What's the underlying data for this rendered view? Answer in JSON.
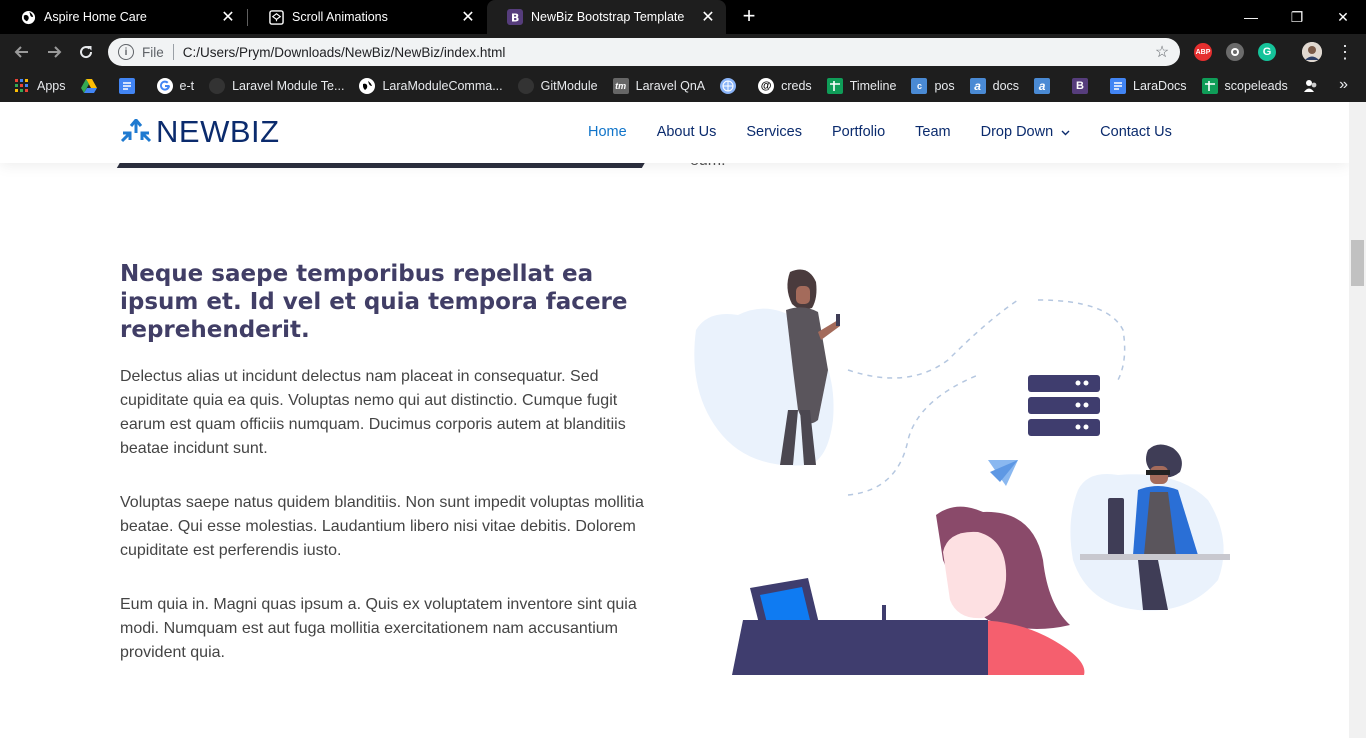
{
  "browser": {
    "tabs": [
      {
        "title": "Aspire Home Care",
        "icon": "globe-icon",
        "active": false
      },
      {
        "title": "Scroll Animations",
        "icon": "codepen-icon",
        "active": false
      },
      {
        "title": "NewBiz Bootstrap Template",
        "icon": "bootstrap-icon",
        "active": true
      }
    ],
    "new_tab": "+",
    "window_controls": {
      "minimize": "—",
      "restore": "❐",
      "close": "✕"
    },
    "omnibox": {
      "scheme": "File",
      "url": "C:/Users/Prym/Downloads/NewBiz/NewBiz/index.html"
    },
    "extensions": [
      {
        "name": "adblock-plus-icon",
        "label": "ABP",
        "color": "#e52f2f"
      },
      {
        "name": "extension-circle-icon",
        "label": "",
        "color": "#6b6b6b"
      },
      {
        "name": "grammarly-icon",
        "label": "G",
        "color": "#15c39a"
      }
    ]
  },
  "bookmarks": [
    {
      "label": "Apps",
      "icon": "apps-grid-icon",
      "color": "#4285f4"
    },
    {
      "label": "",
      "icon": "google-drive-icon",
      "color": "#fbbc04"
    },
    {
      "label": "",
      "icon": "google-docs-icon",
      "color": "#4285f4"
    },
    {
      "label": "e-t",
      "icon": "google-icon",
      "color": "#ffffff"
    },
    {
      "label": "Laravel Module Te...",
      "icon": "github-icon",
      "color": "#333333"
    },
    {
      "label": "LaraModuleComma...",
      "icon": "globe-icon",
      "color": "#ffffff"
    },
    {
      "label": "GitModule",
      "icon": "github-icon",
      "color": "#333333"
    },
    {
      "label": "Laravel QnA",
      "icon": "tm-icon",
      "color": "#666666"
    },
    {
      "label": "",
      "icon": "globe-blue-icon",
      "color": "#8ab4f8"
    },
    {
      "label": "creds",
      "icon": "at-icon",
      "color": "#ffffff"
    },
    {
      "label": "Timeline",
      "icon": "sheets-icon",
      "color": "#0f9d58"
    },
    {
      "label": "pos",
      "icon": "pos-icon",
      "color": "#4a8ad4"
    },
    {
      "label": "docs",
      "icon": "a-icon",
      "color": "#4a8ad4"
    },
    {
      "label": "",
      "icon": "a-icon",
      "color": "#4a8ad4"
    },
    {
      "label": "",
      "icon": "bootstrap-icon",
      "color": "#563d7c"
    },
    {
      "label": "LaraDocs",
      "icon": "google-docs-icon",
      "color": "#4285f4"
    },
    {
      "label": "scopeleads",
      "icon": "sheets-icon",
      "color": "#0f9d58"
    },
    {
      "label": "",
      "icon": "people-icon",
      "color": "#ffffff"
    }
  ],
  "site": {
    "logo": "NEWBIZ",
    "nav": [
      {
        "label": "Home",
        "active": true
      },
      {
        "label": "About Us",
        "active": false
      },
      {
        "label": "Services",
        "active": false
      },
      {
        "label": "Portfolio",
        "active": false
      },
      {
        "label": "Team",
        "active": false
      },
      {
        "label": "Drop Down",
        "active": false,
        "dropdown": true
      },
      {
        "label": "Contact Us",
        "active": false
      }
    ],
    "prev_text": "eum.",
    "heading": "Neque saepe temporibus repellat ea ipsum et. Id vel et quia tempora facere reprehenderit.",
    "paragraphs": [
      "Delectus alias ut incidunt delectus nam placeat in consequatur. Sed cupiditate quia ea quis. Voluptas nemo qui aut distinctio. Cumque fugit earum est quam officiis numquam. Ducimus corporis autem at blanditiis beatae incidunt sunt.",
      "Voluptas saepe natus quidem blanditiis. Non sunt impedit voluptas mollitia beatae. Qui esse molestias. Laudantium libero nisi vitae debitis. Dolorem cupiditate est perferendis iusto.",
      "Eum quia in. Magni quas ipsum a. Quis ex voluptatem inventore sint quia modi. Numquam est aut fuga mollitia exercitationem nam accusantium provident quia."
    ]
  },
  "colors": {
    "heading": "#413e66",
    "nav": "#0b2b6d",
    "nav_active": "#1074c9",
    "accent_pink": "#f55f6e",
    "accent_blue": "#0f7bf2"
  }
}
